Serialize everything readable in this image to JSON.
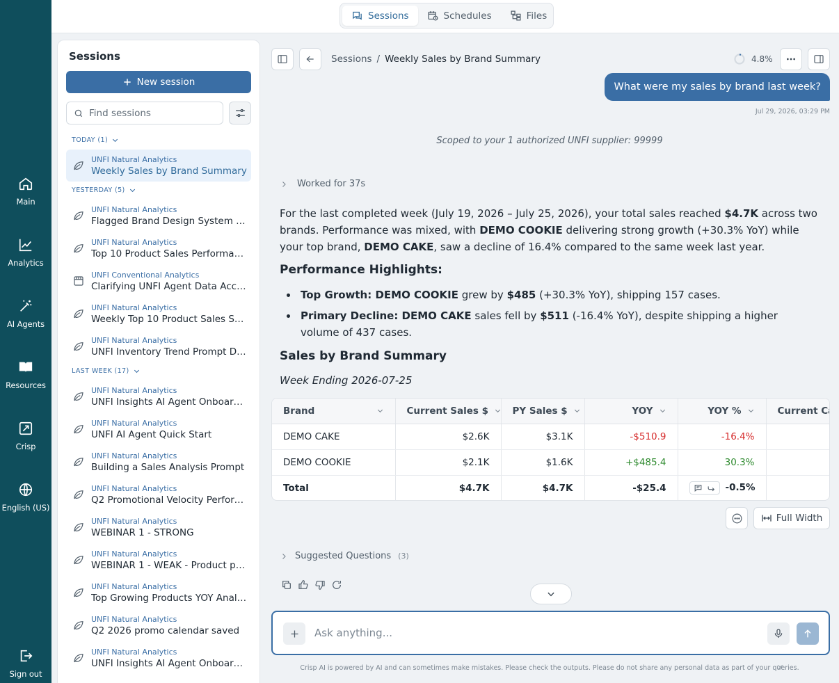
{
  "rail": {
    "items": [
      {
        "label": "Main",
        "icon": "home-icon"
      },
      {
        "label": "Analytics",
        "icon": "chart-icon"
      },
      {
        "label": "AI Agents",
        "icon": "magic-wand-icon"
      },
      {
        "label": "Resources",
        "icon": "book-icon"
      },
      {
        "label": "Crisp",
        "icon": "crisp-icon"
      },
      {
        "label": "English (US)",
        "icon": "globe-icon"
      },
      {
        "label": "Sign out",
        "icon": "sign-out-icon"
      }
    ]
  },
  "topbar": {
    "tabs": [
      {
        "label": "Sessions",
        "icon": "chat-icon",
        "active": true
      },
      {
        "label": "Schedules",
        "icon": "calendar-clock-icon",
        "active": false
      },
      {
        "label": "Files",
        "icon": "folder-tree-icon",
        "active": false
      }
    ]
  },
  "sessions": {
    "title": "Sessions",
    "new_label": "New session",
    "search_placeholder": "Find sessions",
    "groups": [
      {
        "label": "TODAY (1)",
        "items": [
          {
            "category": "UNFI Natural Analytics",
            "title": "Weekly Sales by Brand Summary",
            "icon": "leaf-icon",
            "active": true
          }
        ]
      },
      {
        "label": "YESTERDAY (5)",
        "items": [
          {
            "category": "UNFI Natural Analytics",
            "title": "Flagged Brand Design System Re...",
            "icon": "leaf-icon"
          },
          {
            "category": "UNFI Natural Analytics",
            "title": "Top 10 Product Sales Performance",
            "icon": "leaf-icon"
          },
          {
            "category": "UNFI Conventional Analytics",
            "title": "Clarifying UNFI Agent Data Access",
            "icon": "store-icon"
          },
          {
            "category": "UNFI Natural Analytics",
            "title": "Weekly Top 10 Product Sales Sum...",
            "icon": "leaf-icon"
          },
          {
            "category": "UNFI Natural Analytics",
            "title": "UNFI Inventory Trend Prompt De...",
            "icon": "leaf-icon"
          }
        ]
      },
      {
        "label": "LAST WEEK (17)",
        "items": [
          {
            "category": "UNFI Natural Analytics",
            "title": "UNFI Insights AI Agent Onboarding",
            "icon": "leaf-icon"
          },
          {
            "category": "UNFI Natural Analytics",
            "title": "UNFI AI Agent Quick Start",
            "icon": "leaf-icon"
          },
          {
            "category": "UNFI Natural Analytics",
            "title": "Building a Sales Analysis Prompt",
            "icon": "leaf-icon"
          },
          {
            "category": "UNFI Natural Analytics",
            "title": "Q2 Promotional Velocity Perform...",
            "icon": "leaf-icon"
          },
          {
            "category": "UNFI Natural Analytics",
            "title": "WEBINAR 1 - STRONG",
            "icon": "leaf-icon"
          },
          {
            "category": "UNFI Natural Analytics",
            "title": "WEBINAR 1 - WEAK - Product pe...",
            "icon": "leaf-icon"
          },
          {
            "category": "UNFI Natural Analytics",
            "title": "Top Growing Products YOY Analy...",
            "icon": "leaf-icon"
          },
          {
            "category": "UNFI Natural Analytics",
            "title": "Q2 2026 promo calendar saved",
            "icon": "leaf-icon"
          },
          {
            "category": "UNFI Natural Analytics",
            "title": "UNFI Insights AI Agent Onboardin...",
            "icon": "leaf-icon"
          }
        ]
      }
    ]
  },
  "chat": {
    "breadcrumb": {
      "root": "Sessions",
      "sep": "/",
      "current": "Weekly Sales by Brand Summary"
    },
    "progress": "4.8%",
    "progress_value": 0.048,
    "user_message": "What were my sales by brand last week?",
    "timestamp": "Jul 29, 2026, 03:29 PM",
    "scope_note": "Scoped to your 1 authorized UNFI supplier: 99999",
    "worked_label": "Worked for 37s",
    "intro": {
      "p1": "For the last completed week (July 19, 2026 – July 25, 2026), your total sales reached ",
      "b1": "$4.7K",
      "p2": " across two brands. Performance was mixed, with ",
      "b2": "DEMO COOKIE",
      "p3": " delivering strong growth (+30.3% YoY) while your top brand, ",
      "b3": "DEMO CAKE",
      "p4": ", saw a decline of 16.4% compared to the same week last year."
    },
    "highlights_heading": "Performance Highlights:",
    "highlights": [
      {
        "lead": "Top Growth: DEMO COOKIE",
        "t1": " grew by ",
        "b": "$485",
        "t2": " (+30.3% YoY), shipping 157 cases."
      },
      {
        "lead": "Primary Decline: DEMO CAKE",
        "t1": " sales fell by ",
        "b": "$511",
        "t2": " (-16.4% YoY), despite shipping a higher volume of 437 cases."
      }
    ],
    "summary_heading": "Sales by Brand Summary",
    "week_label": "Week Ending 2026-07-25",
    "table": {
      "headers": [
        "Brand",
        "Current Sales $",
        "PY Sales $",
        "YOY",
        "YOY %",
        "Current Cases"
      ],
      "rows": [
        {
          "brand": "DEMO CAKE",
          "cur": "$2.6K",
          "py": "$3.1K",
          "yoy": "-$510.9",
          "yoyp": "-16.4%",
          "cases": ""
        },
        {
          "brand": "DEMO COOKIE",
          "cur": "$2.1K",
          "py": "$1.6K",
          "yoy": "+$485.4",
          "yoyp": "30.3%",
          "cases": ""
        },
        {
          "brand": "Total",
          "cur": "$4.7K",
          "py": "$4.7K",
          "yoy": "-$25.4",
          "yoyp": "-0.5%",
          "cases": ""
        }
      ]
    },
    "full_width_label": "Full Width",
    "suggested_label": "Suggested Questions",
    "suggested_count": "(3)",
    "composer_placeholder": "Ask anything...",
    "disclaimer": "Crisp AI is powered by AI and can sometimes make mistakes. Please check the outputs. Please do not share any personal data as part of your queries."
  },
  "colors": {
    "rail": "#0f4e5c",
    "accent": "#3a6ea5",
    "negative": "#d62c2c",
    "positive": "#2e8a2e"
  }
}
